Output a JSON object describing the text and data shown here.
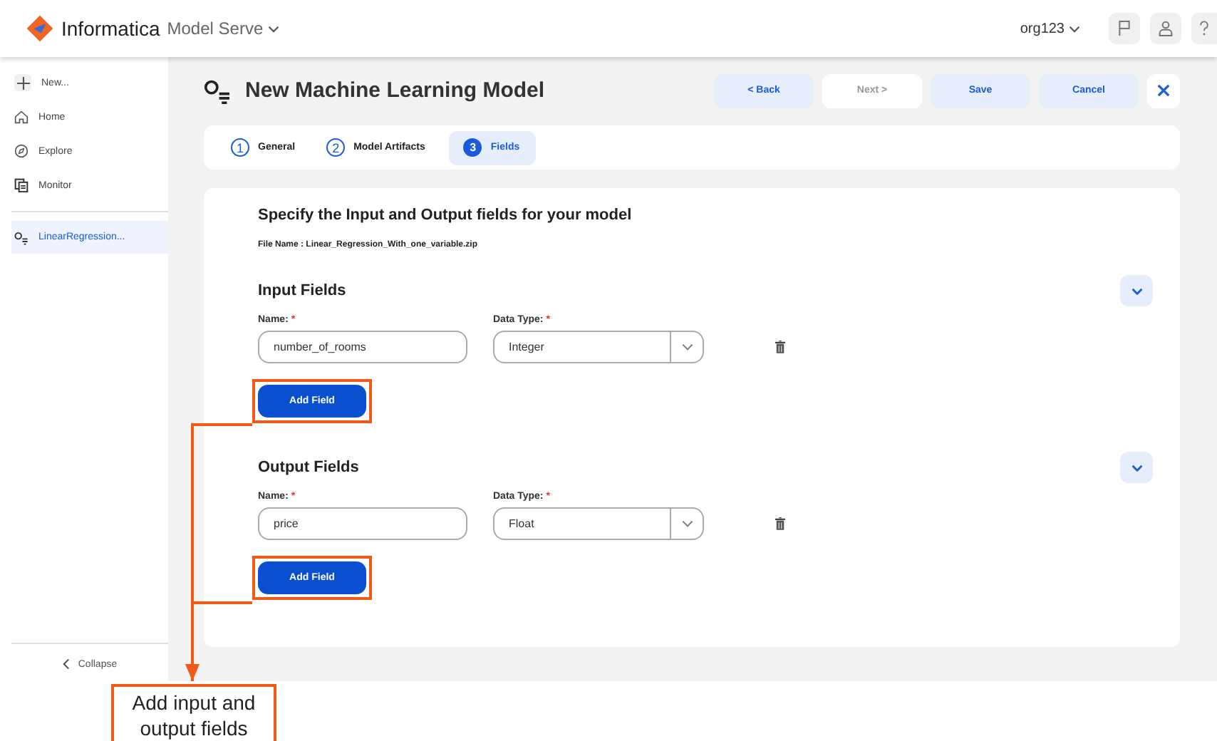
{
  "header": {
    "brand": "Informatica",
    "product": "Model Serve",
    "org": "org123"
  },
  "sidebar": {
    "new_label": "New...",
    "items": [
      {
        "kind": "home",
        "label": "Home",
        "selected": false
      },
      {
        "kind": "explore",
        "label": "Explore",
        "selected": false
      },
      {
        "kind": "monitor",
        "label": "Monitor",
        "selected": false
      }
    ],
    "recent": [
      {
        "label": "LinearRegression...",
        "selected": true
      }
    ],
    "collapse": "Collapse"
  },
  "page": {
    "title": "New Machine Learning Model",
    "buttons": [
      {
        "label": "< Back",
        "disabled": false
      },
      {
        "label": "Next >",
        "disabled": true
      },
      {
        "label": "Save",
        "disabled": false
      },
      {
        "label": "Cancel",
        "disabled": false
      }
    ],
    "steps": [
      {
        "number": "1",
        "label": "General",
        "selected": false
      },
      {
        "number": "2",
        "label": "Model Artifacts",
        "selected": false
      },
      {
        "number": "3",
        "label": "Fields",
        "selected": true
      }
    ],
    "heading": "Specify the Input and Output fields for your model",
    "file_name": "File Name : Linear_Regression_With_one_variable.zip",
    "sections": [
      {
        "title": "Input Fields",
        "name_label": "Name:",
        "type_label": "Data Type:",
        "required": "*",
        "rows": [
          {
            "name": "number_of_rooms",
            "type": "Integer"
          }
        ],
        "add_button": "Add Field",
        "highlighted": true
      },
      {
        "title": "Output Fields",
        "name_label": "Name:",
        "type_label": "Data Type:",
        "required": "*",
        "rows": [
          {
            "name": "price",
            "type": "Float"
          }
        ],
        "add_button": "Add Field",
        "highlighted": true
      }
    ]
  },
  "annotation": {
    "text": "Add input and output fields"
  }
}
